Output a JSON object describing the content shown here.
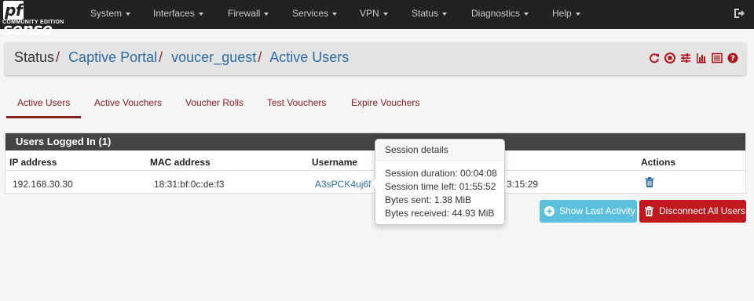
{
  "brand": {
    "name": "pfsense",
    "name_pf": "pf",
    "name_rest": "sense",
    "edition": "COMMUNITY EDITION"
  },
  "nav": {
    "items": [
      "System",
      "Interfaces",
      "Firewall",
      "Services",
      "VPN",
      "Status",
      "Diagnostics",
      "Help"
    ],
    "logout_icon": "sign-out-icon"
  },
  "breadcrumb": {
    "items": [
      "Status",
      "Captive Portal",
      "voucer_guest",
      "Active Users"
    ],
    "separator": "/",
    "icons": [
      "reload-icon",
      "stop-circle-icon",
      "sliders-icon",
      "bar-chart-icon",
      "list-alt-icon",
      "help-icon"
    ]
  },
  "tabs": {
    "items": [
      "Active Users",
      "Active Vouchers",
      "Voucher Rolls",
      "Test Vouchers",
      "Expire Vouchers"
    ],
    "active": "Active Users"
  },
  "table": {
    "title": "Users Logged In (1)",
    "headers": [
      "IP address",
      "MAC address",
      "Username",
      "Actions"
    ],
    "rows": [
      {
        "ip": "192.168.30.30",
        "mac": "18:31:bf:0c:de:f3",
        "username": "A3sPCK4uj6f",
        "last_activity_partial": "3:15:29"
      }
    ]
  },
  "popover": {
    "title": "Session details",
    "lines": [
      "Session duration: 00:04:08",
      "Session time left: 01:55:52",
      "Bytes sent: 1.38 MiB",
      "Bytes received: 44.93 MiB"
    ]
  },
  "buttons": {
    "show_last_activity": "Show Last Activity",
    "disconnect_all": "Disconnect All Users"
  },
  "colors": {
    "navbar": "#222222",
    "brand_red": "#8b1e1e",
    "link_blue": "#2b6ca3",
    "info": "#5bc0de",
    "danger": "#c0181f",
    "panel_head": "#444444"
  }
}
